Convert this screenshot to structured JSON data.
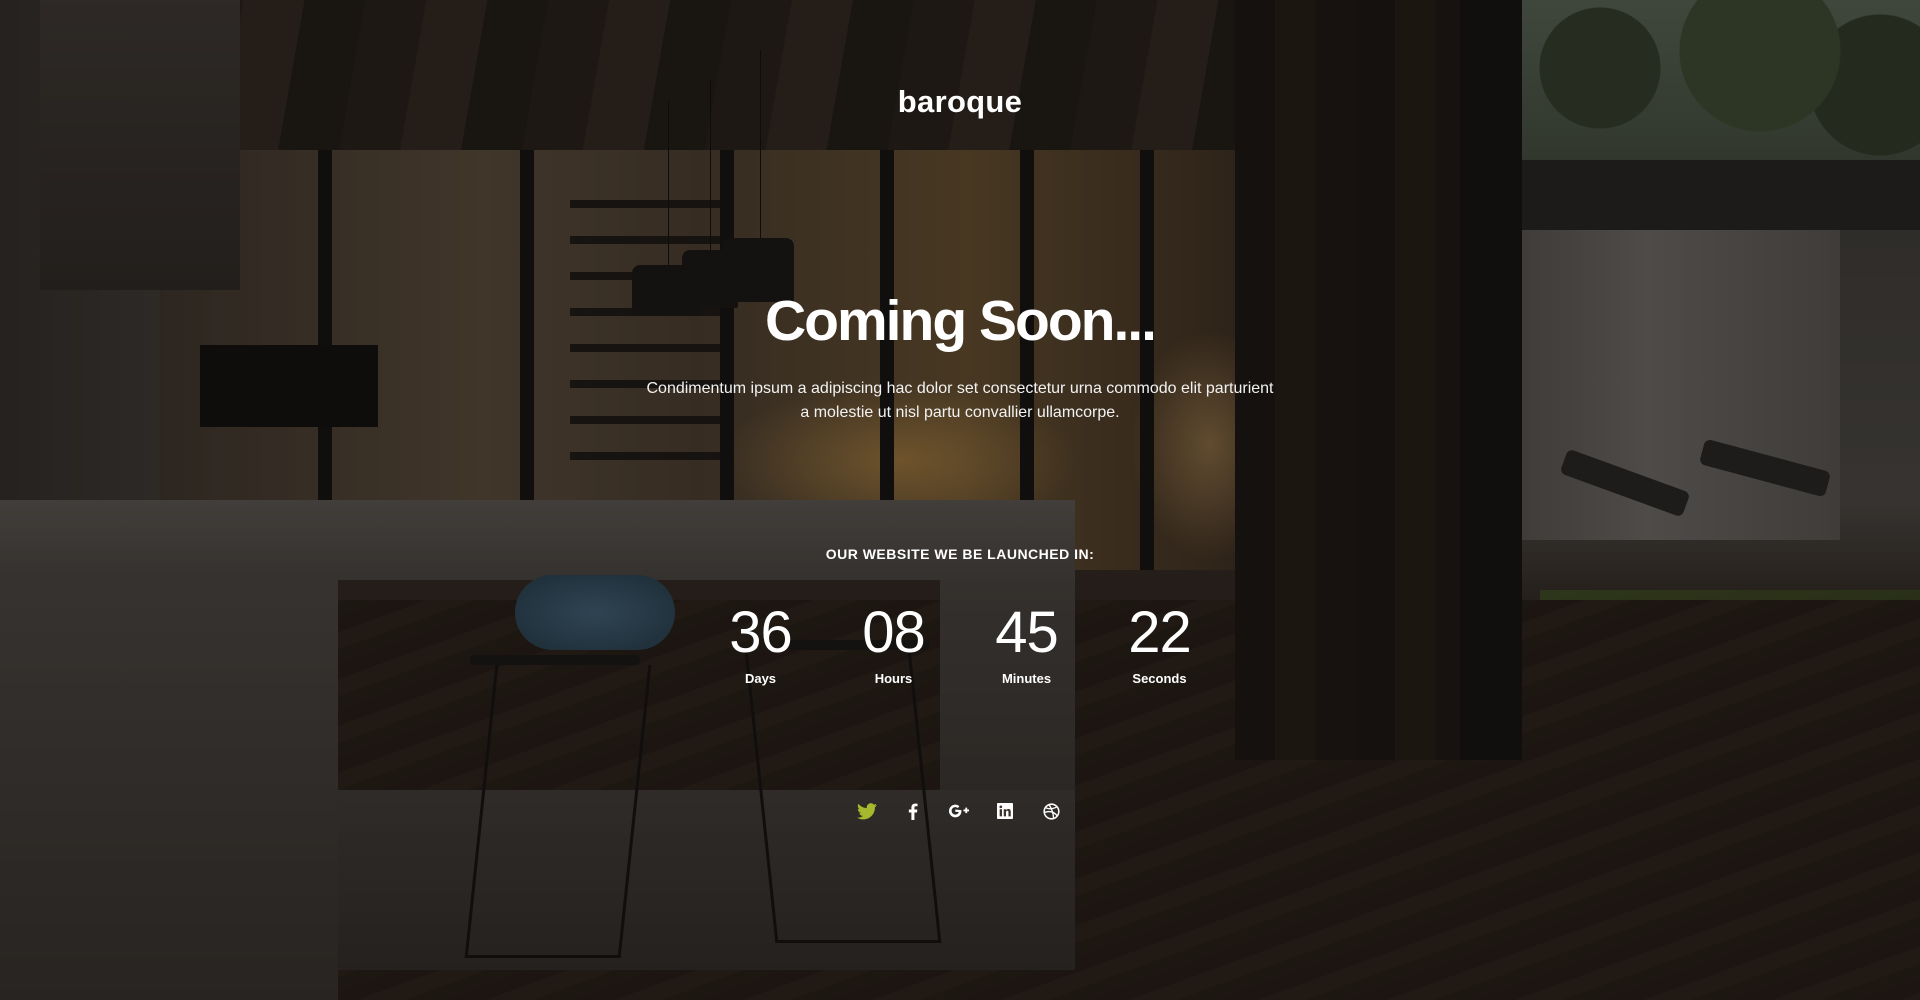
{
  "brand": {
    "logo_text": "baroque"
  },
  "hero": {
    "headline": "Coming Soon...",
    "description": "Condimentum ipsum a adipiscing hac dolor set consectetur urna commodo elit parturient a molestie ut nisl partu convallier ullamcorpe."
  },
  "countdown": {
    "label": "OUR WEBSITE WE BE LAUNCHED IN:",
    "units": [
      {
        "value": "36",
        "label": "Days"
      },
      {
        "value": "08",
        "label": "Hours"
      },
      {
        "value": "45",
        "label": "Minutes"
      },
      {
        "value": "22",
        "label": "Seconds"
      }
    ]
  },
  "social": {
    "icons": [
      "twitter-icon",
      "facebook-icon",
      "google-plus-icon",
      "linkedin-icon",
      "dribbble-icon"
    ],
    "colors": {
      "twitter": "#a6b82e",
      "default": "#ffffff"
    }
  }
}
